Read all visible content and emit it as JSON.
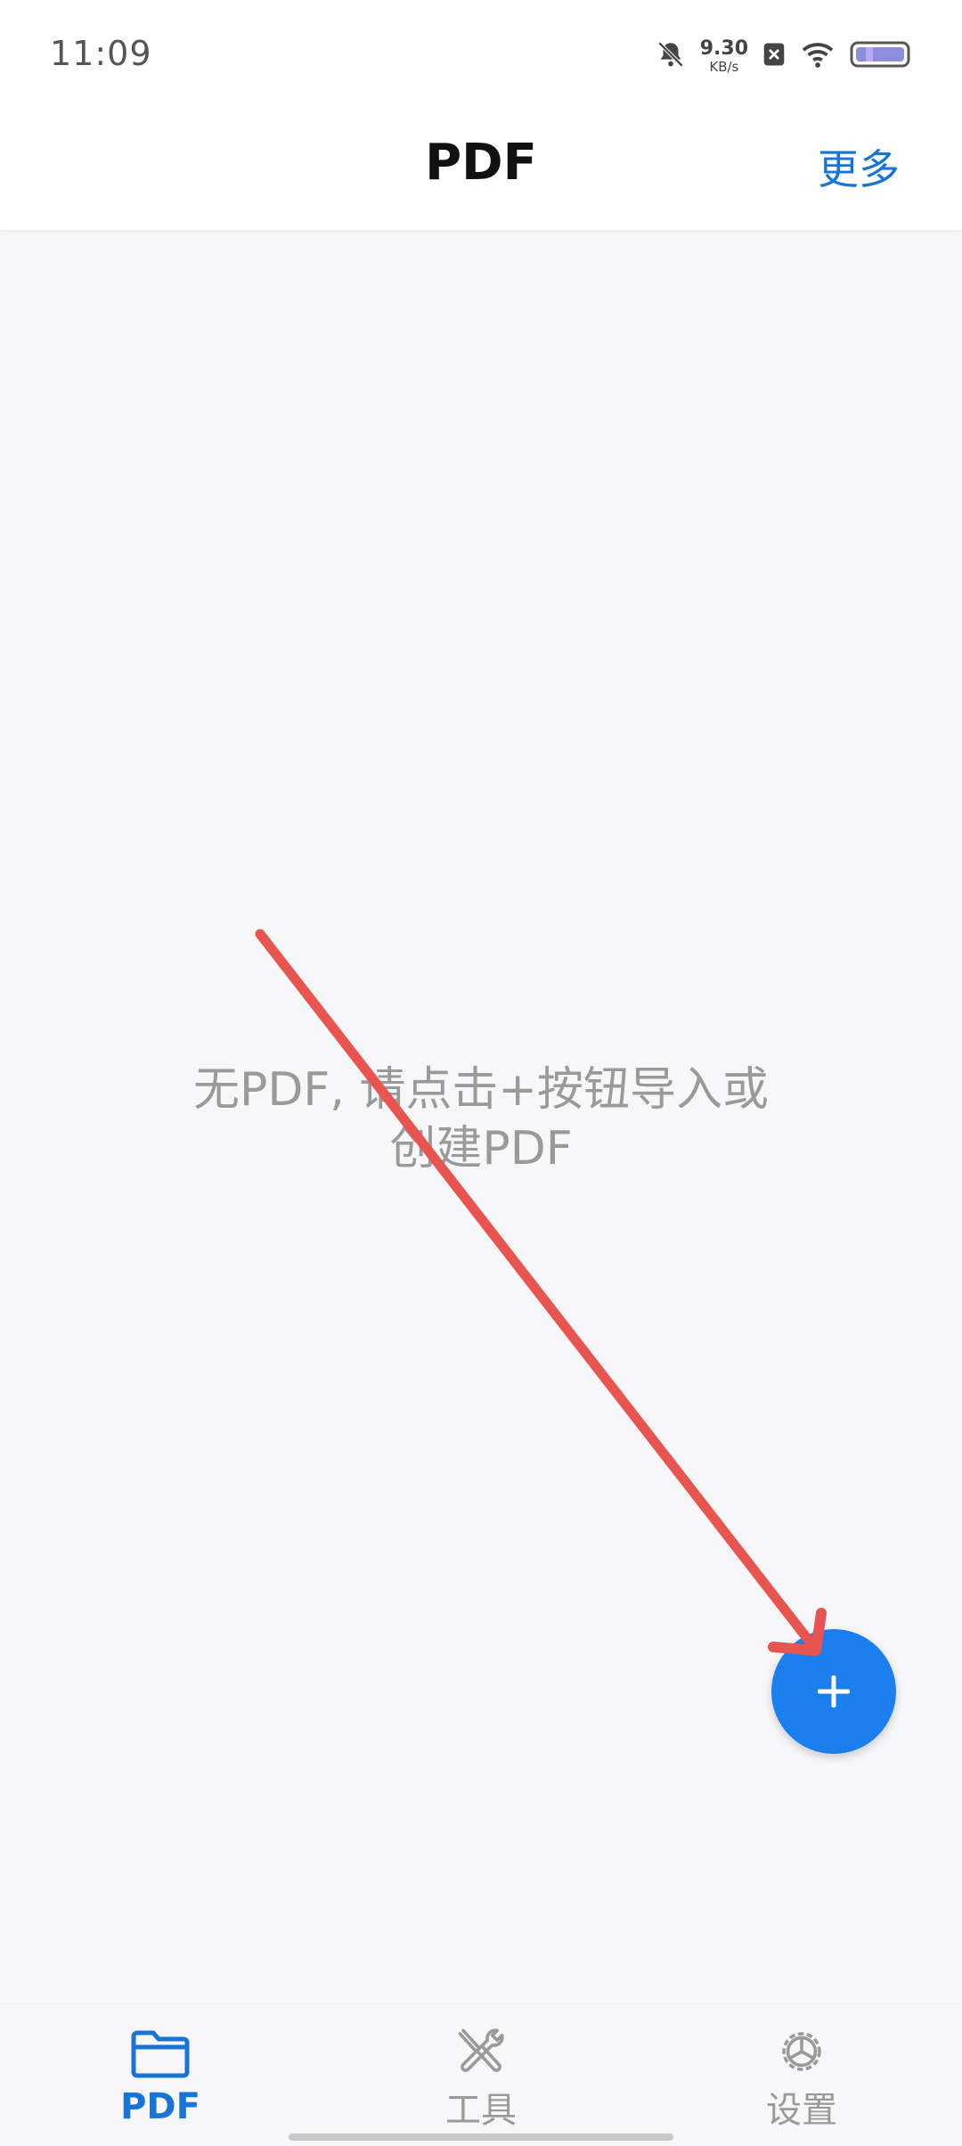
{
  "status_bar": {
    "time": "11:09",
    "net_speed_value": "9.30",
    "net_speed_unit": "KB/s",
    "icons": [
      "bell-muted-icon",
      "sim-blocked-icon",
      "wifi-icon",
      "battery-icon"
    ]
  },
  "header": {
    "title": "PDF",
    "more_label": "更多"
  },
  "empty_state": {
    "line1": "无PDF, 请点击+按钮导入或",
    "line2": "创建PDF"
  },
  "fab": {
    "icon": "plus-icon"
  },
  "bottom_nav": {
    "items": [
      {
        "label": "PDF",
        "icon": "folder-icon",
        "active": true
      },
      {
        "label": "工具",
        "icon": "tools-icon",
        "active": false
      },
      {
        "label": "设置",
        "icon": "gear-icon",
        "active": false
      }
    ]
  },
  "colors": {
    "accent": "#1874d8",
    "fab": "#1b7ff0",
    "arrow": "#e85450",
    "muted_text": "#9a9a9a"
  }
}
